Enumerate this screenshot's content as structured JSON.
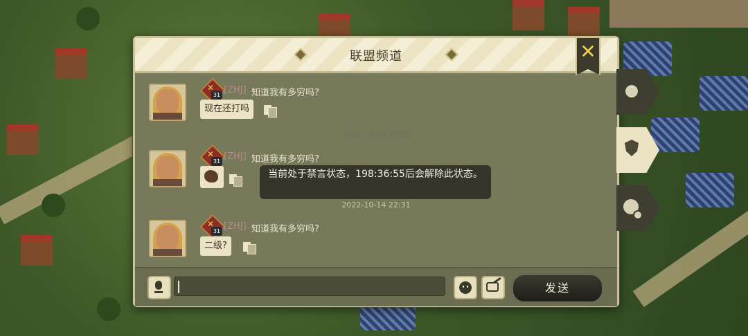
{
  "panel": {
    "title": "联盟频道",
    "close_label": "✕"
  },
  "messages": [
    {
      "alliance_tag": "[ZHJ]",
      "sender": "知道我有多穷吗?",
      "level": "31",
      "text": "现在还打吗",
      "type": "text"
    },
    {
      "alliance_tag": "[ZHJ]",
      "sender": "知道我有多穷吗?",
      "level": "31",
      "text": "",
      "type": "emoji"
    },
    {
      "alliance_tag": "[ZHJ]",
      "sender": "知道我有多穷吗?",
      "level": "31",
      "text": "二级?",
      "type": "text"
    }
  ],
  "timestamps": {
    "hidden_behind_toast": "2022-10-14 22:12",
    "second": "2022-10-14 22:31"
  },
  "toast": {
    "text": "当前处于禁言状态，198:36:55后会解除此状态。"
  },
  "input_bar": {
    "input_value": "",
    "send_label": "发送"
  },
  "side_tabs": [
    {
      "name": "world",
      "icon": "globe-icon",
      "active": false
    },
    {
      "name": "alliance",
      "icon": "shield-icon",
      "active": true
    },
    {
      "name": "friends",
      "icon": "friend-chat-icon",
      "active": false
    }
  ],
  "colors": {
    "panel_bg": "#76795a",
    "header_bg": "#ece3c2",
    "close_accent": "#f2cf4d",
    "alliance_tag": "#b58b8b",
    "send_button": "#1e1e18"
  }
}
